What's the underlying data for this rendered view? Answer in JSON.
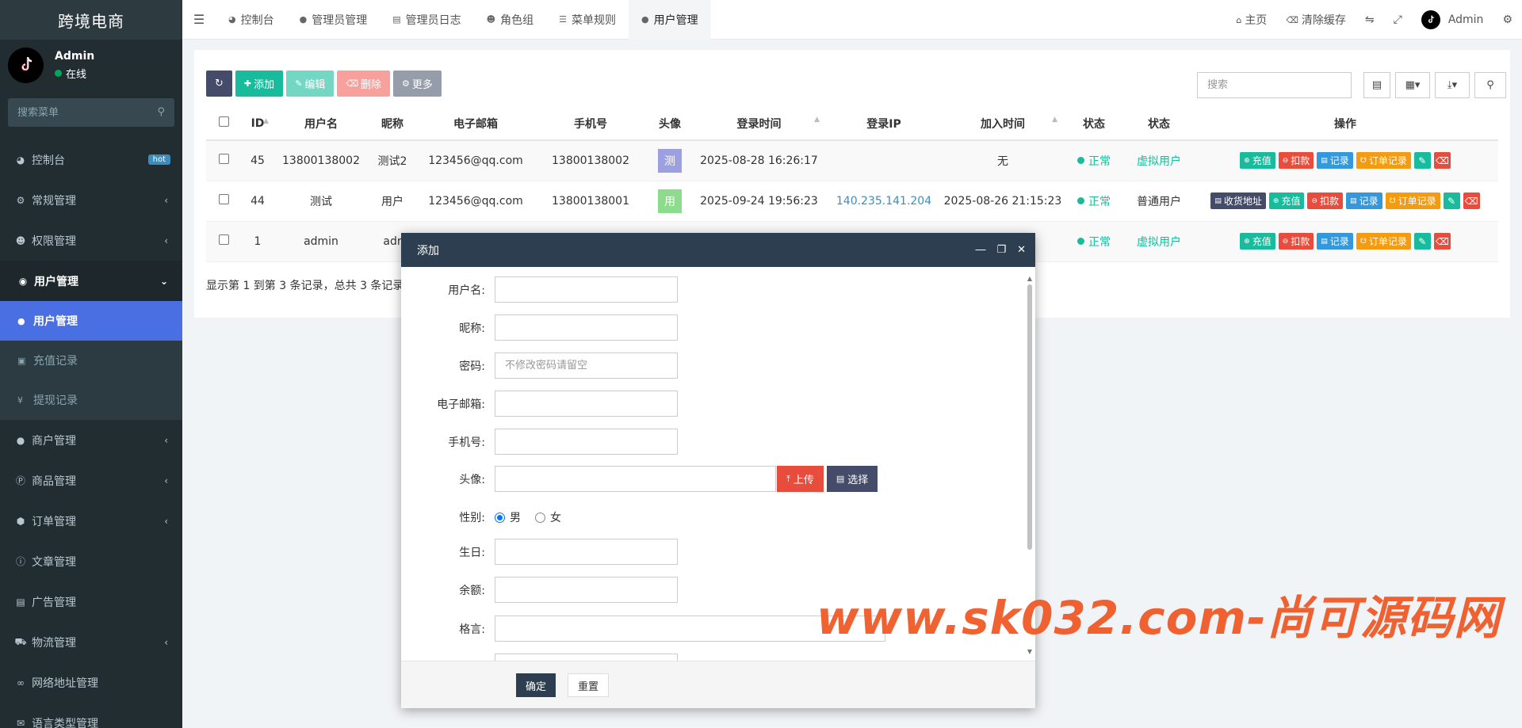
{
  "sidebar": {
    "logo": "跨境电商",
    "user": {
      "name": "Admin",
      "status": "在线"
    },
    "search_placeholder": "搜索菜单",
    "items": [
      {
        "label": "控制台",
        "icon": "dashboard-icon",
        "badge": "hot"
      },
      {
        "label": "常规管理",
        "icon": "cogs-icon"
      },
      {
        "label": "权限管理",
        "icon": "group-icon"
      },
      {
        "label": "用户管理",
        "icon": "user-circle-icon",
        "open": true
      },
      {
        "label": "商户管理",
        "icon": "apple-icon"
      },
      {
        "label": "商品管理",
        "icon": "product-icon"
      },
      {
        "label": "订单管理",
        "icon": "cube-icon"
      },
      {
        "label": "文章管理",
        "icon": "question-icon"
      },
      {
        "label": "广告管理",
        "icon": "card-icon"
      },
      {
        "label": "物流管理",
        "icon": "truck-icon"
      },
      {
        "label": "网络地址管理",
        "icon": "link-icon"
      },
      {
        "label": "语言类型管理",
        "icon": "language-icon"
      }
    ],
    "submenu": [
      {
        "label": "用户管理",
        "icon": "user-icon",
        "active": true
      },
      {
        "label": "充值记录",
        "icon": "money-icon"
      },
      {
        "label": "提现记录",
        "icon": "yen-icon"
      }
    ]
  },
  "topbar": {
    "tabs": [
      {
        "label": "控制台",
        "icon": "dashboard-icon"
      },
      {
        "label": "管理员管理",
        "icon": "user-icon"
      },
      {
        "label": "管理员日志",
        "icon": "list-icon"
      },
      {
        "label": "角色组",
        "icon": "group-icon"
      },
      {
        "label": "菜单规则",
        "icon": "bars-icon"
      },
      {
        "label": "用户管理",
        "icon": "user-icon",
        "active": true
      }
    ],
    "right": {
      "home": "主页",
      "clear_cache": "清除缓存",
      "admin": "Admin"
    }
  },
  "toolbar": {
    "add": "添加",
    "edit": "编辑",
    "delete": "删除",
    "more": "更多"
  },
  "search": {
    "placeholder": "搜索"
  },
  "table": {
    "headers": [
      "ID",
      "用户名",
      "昵称",
      "电子邮箱",
      "手机号",
      "头像",
      "登录时间",
      "登录IP",
      "加入时间",
      "状态",
      "状态",
      "操作"
    ],
    "rows": [
      {
        "id": "45",
        "username": "13800138002",
        "nickname": "测试2",
        "email": "123456@qq.com",
        "mobile": "13800138002",
        "avatar_char": "测",
        "avatar_color": "#9c9fe0",
        "login_time": "2025-08-28 16:26:17",
        "login_ip": "",
        "join_time": "无",
        "status": "正常",
        "type": "虚拟用户"
      },
      {
        "id": "44",
        "username": "测试",
        "nickname": "用户",
        "email": "123456@qq.com",
        "mobile": "13800138001",
        "avatar_char": "用",
        "avatar_color": "#8ddc8d",
        "login_time": "2025-09-24 19:56:23",
        "login_ip": "140.235.141.204",
        "join_time": "2025-08-26 21:15:23",
        "status": "正常",
        "type": "普通用户"
      },
      {
        "id": "1",
        "username": "admin",
        "nickname": "adr",
        "status": "正常",
        "type": "虚拟用户"
      }
    ],
    "ops": {
      "address": "收货地址",
      "recharge": "充值",
      "deduct": "扣款",
      "record": "记录",
      "orders": "订单记录"
    },
    "footer": "显示第 1 到第 3 条记录，总共 3 条记录"
  },
  "modal": {
    "title": "添加",
    "fields": {
      "username": "用户名:",
      "nickname": "昵称:",
      "password": "密码:",
      "password_placeholder": "不修改密码请留空",
      "email": "电子邮箱:",
      "mobile": "手机号:",
      "avatar": "头像:",
      "upload": "上传",
      "choose": "选择",
      "gender": "性别:",
      "male": "男",
      "female": "女",
      "birthday": "生日:",
      "balance": "余额:",
      "motto": "格言:"
    },
    "confirm": "确定",
    "reset": "重置"
  },
  "watermark": "www.sk032.com-尚可源码网"
}
